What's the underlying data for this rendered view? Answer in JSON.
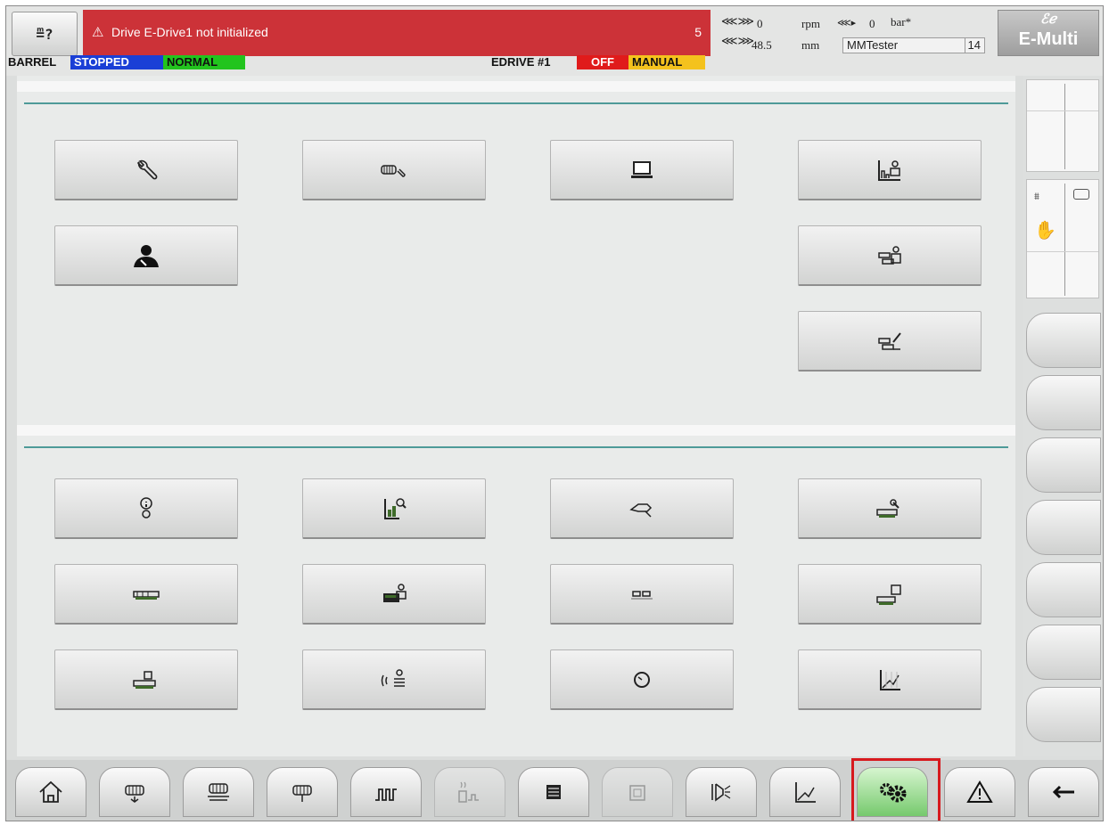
{
  "header": {
    "logout_glyph": "≞?",
    "alarm": {
      "message": "Drive E-Drive1 not initialized",
      "count": "5",
      "icon": "warning-triangle-icon",
      "color": "#cc3238"
    },
    "stats": {
      "speed_value": "0",
      "speed_unit": "rpm",
      "pressure_value": "0",
      "pressure_unit": "bar*",
      "position_value": "48.5",
      "position_unit": "mm",
      "user": "MMTester",
      "user_level": "14"
    },
    "logo": {
      "symbol": "ℰℯ",
      "name": "E-Multi"
    }
  },
  "status_line": {
    "barrel_label": "BARREL",
    "barrel_state": "STOPPED",
    "barrel_mode": "NORMAL",
    "drive_label": "EDRIVE #1",
    "drive_state": "OFF",
    "drive_mode": "MANUAL",
    "colors": {
      "stopped": "#1a3fd6",
      "normal": "#22c41e",
      "off": "#e01b1b",
      "manual": "#f4c21d"
    }
  },
  "main": {
    "top_buttons": [
      {
        "name": "service-wrench-button",
        "icon": "wrench-icon"
      },
      {
        "name": "drive-setup-button",
        "icon": "drive-wrench-icon"
      },
      {
        "name": "hmi-button",
        "icon": "monitor-icon"
      },
      {
        "name": "process-user-button",
        "icon": "chart-user-icon"
      },
      {
        "name": "user-management-button",
        "icon": "user-wrench-icon"
      },
      {
        "name": "machine-user-button",
        "icon": "machine-user-icon"
      },
      {
        "name": "machine-edit-button",
        "icon": "machine-edit-icon"
      }
    ],
    "bottom_buttons": [
      {
        "name": "info-button",
        "icon": "info-icon"
      },
      {
        "name": "log-search-button",
        "icon": "log-search-icon"
      },
      {
        "name": "drive-calibrate-button",
        "icon": "drive-calibrate-icon"
      },
      {
        "name": "machine-wrench-button",
        "icon": "machine-wrench-icon"
      },
      {
        "name": "machine-overview-button",
        "icon": "machine-overview-icon"
      },
      {
        "name": "card-user-button",
        "icon": "card-user-icon"
      },
      {
        "name": "modules-button",
        "icon": "modules-icon"
      },
      {
        "name": "machine-display-button",
        "icon": "machine-display-icon"
      },
      {
        "name": "machine-io-button",
        "icon": "machine-io-icon"
      },
      {
        "name": "network-user-button",
        "icon": "network-user-icon"
      },
      {
        "name": "clock-button",
        "icon": "clock-icon"
      },
      {
        "name": "graph-button",
        "icon": "graph-icon"
      }
    ]
  },
  "nav": {
    "items": [
      {
        "name": "nav-home",
        "icon": "home-icon"
      },
      {
        "name": "nav-injection",
        "icon": "injection-icon"
      },
      {
        "name": "nav-barrel-heating",
        "icon": "barrel-heating-icon"
      },
      {
        "name": "nav-screw",
        "icon": "screw-icon"
      },
      {
        "name": "nav-temperature",
        "icon": "heating-zones-icon"
      },
      {
        "name": "nav-cooling",
        "icon": "cooling-icon"
      },
      {
        "name": "nav-list",
        "icon": "list-icon"
      },
      {
        "name": "nav-io",
        "icon": "io-icon"
      },
      {
        "name": "nav-nozzle",
        "icon": "nozzle-icon"
      },
      {
        "name": "nav-graph",
        "icon": "graph-icon"
      },
      {
        "name": "nav-settings",
        "icon": "gears-icon"
      },
      {
        "name": "nav-alarms",
        "icon": "warning-icon"
      },
      {
        "name": "nav-back",
        "icon": "back-arrow-icon"
      }
    ],
    "active": "nav-settings",
    "active_color": "#76c96d",
    "highlight_color": "#d7191e"
  }
}
